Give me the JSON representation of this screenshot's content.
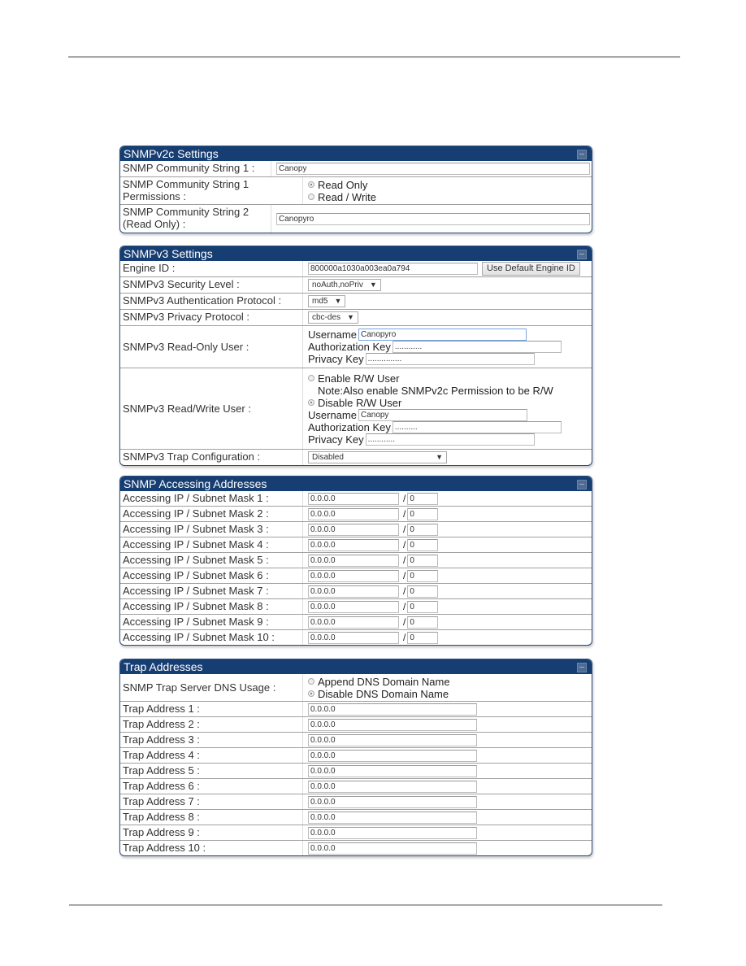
{
  "snmpv2c": {
    "title": "SNMPv2c Settings",
    "community1_label": "SNMP Community String 1 :",
    "community1_value": "Canopy",
    "permissions_label_line1": "SNMP Community String 1",
    "permissions_label_line2": "Permissions :",
    "permissions_options": [
      {
        "label": "Read Only",
        "selected": true
      },
      {
        "label": "Read / Write",
        "selected": false
      }
    ],
    "community2_label_line1": "SNMP Community String 2",
    "community2_label_line2": "(Read Only) :",
    "community2_value": "Canopyro"
  },
  "snmpv3": {
    "title": "SNMPv3 Settings",
    "engine_id_label": "Engine ID :",
    "engine_id_value": "800000a1030a003ea0a794",
    "default_engine_button": "Use Default Engine ID",
    "security_level_label": "SNMPv3 Security Level :",
    "security_level_value": "noAuth,noPriv",
    "auth_protocol_label": "SNMPv3 Authentication Protocol :",
    "auth_protocol_value": "md5",
    "privacy_protocol_label": "SNMPv3 Privacy Protocol :",
    "privacy_protocol_value": "cbc-des",
    "ro_user_label": "SNMPv3 Read-Only User :",
    "ro_user": {
      "username_label": "Username",
      "username_value": "Canopyro",
      "auth_key_label": "Authorization Key",
      "auth_key_value": "............",
      "privacy_key_label": "Privacy Key",
      "privacy_key_value": "..............."
    },
    "rw_user_label": "SNMPv3 Read/Write User :",
    "rw_user": {
      "enable_label": "Enable R/W User",
      "enable_selected": false,
      "note": "Note:Also enable SNMPv2c Permission to be R/W",
      "disable_label": "Disable R/W User",
      "disable_selected": true,
      "username_label": "Username",
      "username_value": "Canopy",
      "auth_key_label": "Authorization Key",
      "auth_key_value": "..........",
      "privacy_key_label": "Privacy Key",
      "privacy_key_value": "............"
    },
    "trap_config_label": "SNMPv3 Trap Configuration :",
    "trap_config_value": "Disabled"
  },
  "accessing": {
    "title": "SNMP Accessing Addresses",
    "rows": [
      {
        "label": "Accessing IP / Subnet Mask 1 :",
        "ip": "0.0.0.0",
        "mask": "0"
      },
      {
        "label": "Accessing IP / Subnet Mask 2 :",
        "ip": "0.0.0.0",
        "mask": "0"
      },
      {
        "label": "Accessing IP / Subnet Mask 3 :",
        "ip": "0.0.0.0",
        "mask": "0"
      },
      {
        "label": "Accessing IP / Subnet Mask 4 :",
        "ip": "0.0.0.0",
        "mask": "0"
      },
      {
        "label": "Accessing IP / Subnet Mask 5 :",
        "ip": "0.0.0.0",
        "mask": "0"
      },
      {
        "label": "Accessing IP / Subnet Mask 6 :",
        "ip": "0.0.0.0",
        "mask": "0"
      },
      {
        "label": "Accessing IP / Subnet Mask 7 :",
        "ip": "0.0.0.0",
        "mask": "0"
      },
      {
        "label": "Accessing IP / Subnet Mask 8 :",
        "ip": "0.0.0.0",
        "mask": "0"
      },
      {
        "label": "Accessing IP / Subnet Mask 9 :",
        "ip": "0.0.0.0",
        "mask": "0"
      },
      {
        "label": "Accessing IP / Subnet Mask 10 :",
        "ip": "0.0.0.0",
        "mask": "0"
      }
    ],
    "slash": "/"
  },
  "trap": {
    "title": "Trap Addresses",
    "dns_usage_label": "SNMP Trap Server DNS Usage :",
    "dns_options": [
      {
        "label": "Append DNS Domain Name",
        "selected": false
      },
      {
        "label": "Disable DNS Domain Name",
        "selected": true
      }
    ],
    "rows": [
      {
        "label": "Trap Address 1 :",
        "value": "0.0.0.0"
      },
      {
        "label": "Trap Address 2 :",
        "value": "0.0.0.0"
      },
      {
        "label": "Trap Address 3 :",
        "value": "0.0.0.0"
      },
      {
        "label": "Trap Address 4 :",
        "value": "0.0.0.0"
      },
      {
        "label": "Trap Address 5 :",
        "value": "0.0.0.0"
      },
      {
        "label": "Trap Address 6 :",
        "value": "0.0.0.0"
      },
      {
        "label": "Trap Address 7 :",
        "value": "0.0.0.0"
      },
      {
        "label": "Trap Address 8 :",
        "value": "0.0.0.0"
      },
      {
        "label": "Trap Address 9 :",
        "value": "0.0.0.0"
      },
      {
        "label": "Trap Address 10 :",
        "value": "0.0.0.0"
      }
    ]
  }
}
